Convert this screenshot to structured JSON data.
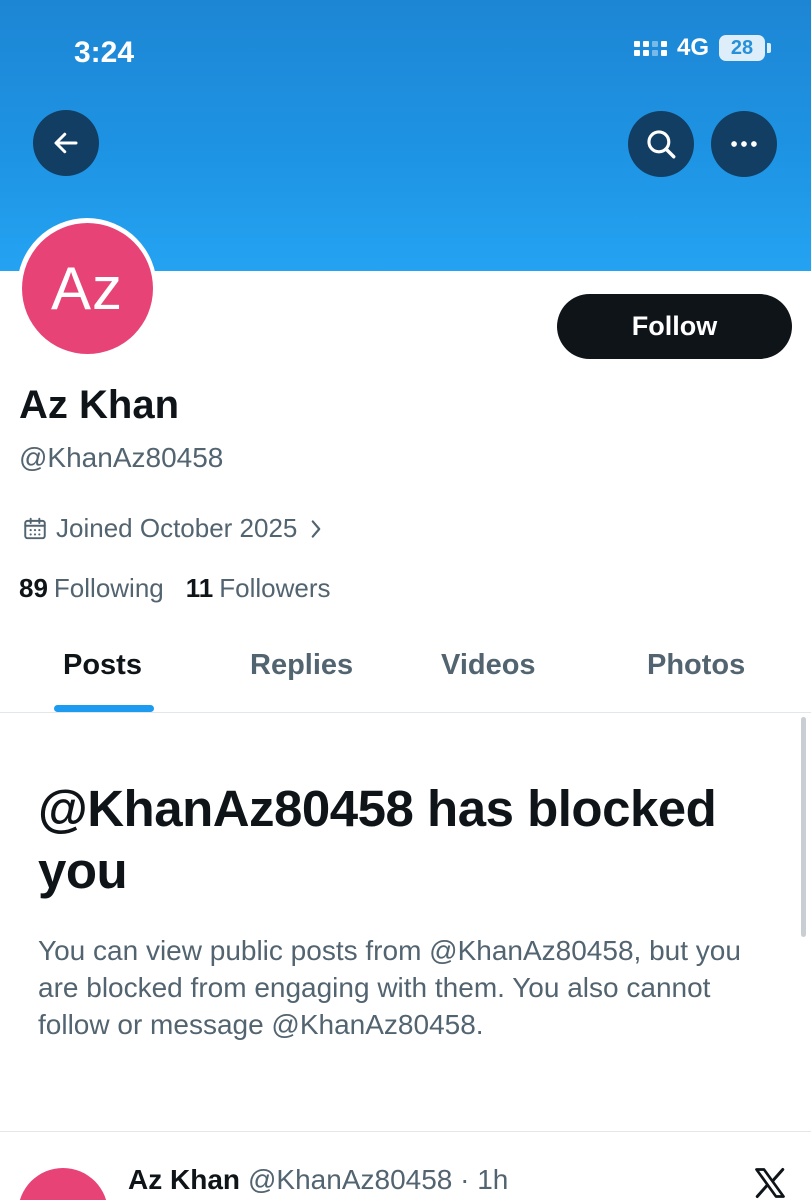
{
  "status_bar": {
    "time": "3:24",
    "network": "4G",
    "battery": "28"
  },
  "header": {
    "back_icon": "arrow-left-icon",
    "search_icon": "search-icon",
    "more_icon": "more-horizontal-icon"
  },
  "profile": {
    "avatar_initials": "Az",
    "follow_label": "Follow",
    "display_name": "Az Khan",
    "handle": "@KhanAz80458",
    "joined": "Joined October 2025",
    "following_count": "89",
    "following_label": "Following",
    "followers_count": "11",
    "followers_label": "Followers"
  },
  "tabs": [
    {
      "label": "Posts",
      "active": true
    },
    {
      "label": "Replies",
      "active": false
    },
    {
      "label": "Videos",
      "active": false
    },
    {
      "label": "Photos",
      "active": false
    }
  ],
  "blocked_notice": {
    "title": "@KhanAz80458 has blocked you",
    "body": "You can view public posts from @KhanAz80458, but you are blocked from engaging with them. You also cannot follow or message @KhanAz80458."
  },
  "post_preview": {
    "name": "Az Khan",
    "handle_time": "@KhanAz80458 · 1h",
    "source_icon": "x-logo-icon"
  },
  "colors": {
    "banner": "#1e93e3",
    "avatar": "#e84377",
    "tab_indicator": "#1d9bf0",
    "follow_button": "#0f1419",
    "secondary_text": "#536471"
  }
}
